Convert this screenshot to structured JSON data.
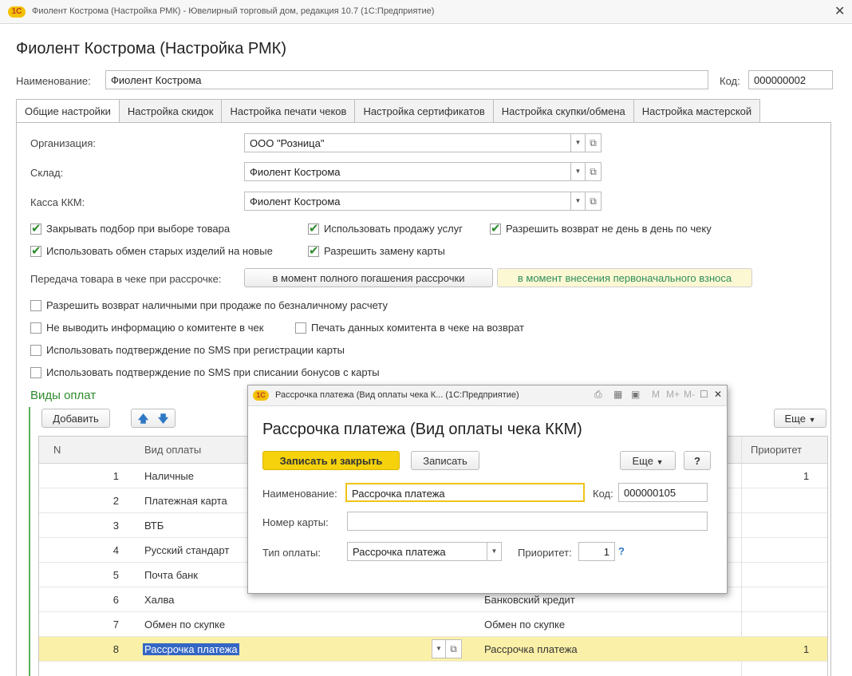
{
  "window": {
    "title": "Фиолент Кострома (Настройка РМК) - Ювелирный торговый дом, редакция 10.7  (1С:Предприятие)",
    "logo": "1С",
    "close": "✕"
  },
  "page_title": "Фиолент Кострома (Настройка РМК)",
  "header": {
    "name_label": "Наименование:",
    "name_value": "Фиолент Кострома",
    "code_label": "Код:",
    "code_value": "000000002"
  },
  "tabs": [
    {
      "label": "Общие настройки",
      "active": true
    },
    {
      "label": "Настройка скидок"
    },
    {
      "label": "Настройка печати чеков"
    },
    {
      "label": "Настройка сертификатов"
    },
    {
      "label": "Настройка скупки/обмена"
    },
    {
      "label": "Настройка мастерской"
    }
  ],
  "general": {
    "org_label": "Организация:",
    "org_value": "ООО \"Розница\"",
    "warehouse_label": "Склад:",
    "warehouse_value": "Фиолент Кострома",
    "register_label": "Касса ККМ:",
    "register_value": "Фиолент Кострома"
  },
  "checkboxes": {
    "close_selection": {
      "label": "Закрывать подбор при выборе товара",
      "checked": true
    },
    "use_services": {
      "label": "Использовать продажу услуг",
      "checked": true
    },
    "allow_return": {
      "label": "Разрешить возврат не день в день по чеку",
      "checked": true
    },
    "use_exchange": {
      "label": "Использовать обмен старых изделий на новые",
      "checked": true
    },
    "allow_card_replace": {
      "label": "Разрешить замену карты",
      "checked": true
    },
    "cash_return": {
      "label": "Разрешить возврат наличными при продаже по безналичному расчету",
      "checked": false
    },
    "no_committent": {
      "label": "Не выводить информацию о комитенте в чек",
      "checked": false
    },
    "print_committent": {
      "label": "Печать данных комитента в чеке на возврат",
      "checked": false
    },
    "sms_card": {
      "label": "Использовать подтверждение по SMS при регистрации карты",
      "checked": false
    },
    "sms_bonus": {
      "label": "Использовать подтверждение по SMS при списании бонусов с карты",
      "checked": false
    }
  },
  "installment": {
    "label": "Передача товара в чеке при рассрочке:",
    "option1": "в момент полного погашения рассрочки",
    "option2": "в момент внесения первоначального взноса",
    "selected": "option2"
  },
  "payments": {
    "section_title": "Виды оплат",
    "add_button": "Добавить",
    "more_button": "Еще",
    "columns": {
      "n": "N",
      "type": "Вид оплаты",
      "priority": "Приоритет"
    },
    "rows": [
      {
        "n": "1",
        "type": "Наличные",
        "kind": "",
        "priority": "1"
      },
      {
        "n": "2",
        "type": "Платежная карта",
        "kind": "",
        "priority": ""
      },
      {
        "n": "3",
        "type": "ВТБ",
        "kind": "",
        "priority": ""
      },
      {
        "n": "4",
        "type": "Русский стандарт",
        "kind": "",
        "priority": ""
      },
      {
        "n": "5",
        "type": "Почта банк",
        "kind": "",
        "priority": ""
      },
      {
        "n": "6",
        "type": "Халва",
        "kind": "Банковский кредит",
        "priority": ""
      },
      {
        "n": "7",
        "type": "Обмен по скупке",
        "kind": "Обмен по скупке",
        "priority": ""
      },
      {
        "n": "8",
        "type": "Рассрочка платежа",
        "kind": "Рассрочка платежа",
        "priority": "1",
        "selected": true
      }
    ]
  },
  "modal": {
    "title": "Рассрочка платежа (Вид оплаты чека К...  (1С:Предприятие)",
    "heading": "Рассрочка платежа (Вид оплаты чека ККМ)",
    "save_close": "Записать и закрыть",
    "save": "Записать",
    "more": "Еще",
    "help": "?",
    "name_label": "Наименование:",
    "name_value": "Рассрочка платежа",
    "code_label": "Код:",
    "code_value": "000000105",
    "card_label": "Номер карты:",
    "card_value": "",
    "paytype_label": "Тип оплаты:",
    "paytype_value": "Рассрочка платежа",
    "priority_label": "Приоритет:",
    "priority_value": "1",
    "priority_help": "?",
    "toolbar": {
      "m": "M",
      "mplus": "M+",
      "mminus": "M-"
    }
  },
  "colors": {
    "accent_green": "#2e8b2e",
    "primary_yellow": "#f5d20b",
    "selection_row": "#fbf0a7"
  }
}
